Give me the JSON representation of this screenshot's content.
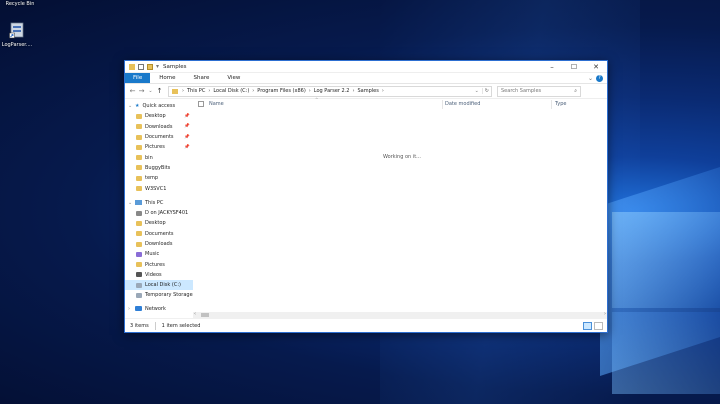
{
  "desktop": {
    "icons": [
      {
        "label": "Recycle Bin",
        "icon": "recycle-bin-icon"
      },
      {
        "label": "LogParser....",
        "icon": "logparser-shortcut-icon"
      }
    ]
  },
  "window": {
    "title": "Samples",
    "ribbon_tabs": [
      "File",
      "Home",
      "Share",
      "View"
    ],
    "breadcrumbs": [
      "This PC",
      "Local Disk (C:)",
      "Program Files (x86)",
      "Log Parser 2.2",
      "Samples"
    ],
    "search_placeholder": "Search Samples",
    "nav": {
      "quick_access": "Quick access",
      "quick_items": [
        {
          "label": "Desktop",
          "pinned": true
        },
        {
          "label": "Downloads",
          "pinned": true
        },
        {
          "label": "Documents",
          "pinned": true
        },
        {
          "label": "Pictures",
          "pinned": true
        },
        {
          "label": "bin",
          "pinned": false
        },
        {
          "label": "BuggyBits",
          "pinned": false
        },
        {
          "label": "temp",
          "pinned": false
        },
        {
          "label": "W3SVC1",
          "pinned": false
        }
      ],
      "this_pc": "This PC",
      "pc_items": [
        "D on JACKYSF401",
        "Desktop",
        "Documents",
        "Downloads",
        "Music",
        "Pictures",
        "Videos",
        "Local Disk (C:)",
        "Temporary Storage"
      ],
      "network": "Network"
    },
    "columns": {
      "checkbox": "",
      "name": "Name",
      "date_modified": "Date modified",
      "type": "Type"
    },
    "working_text": "Working on it...",
    "status": {
      "items": "3 items",
      "selected": "1 item selected"
    }
  },
  "colors": {
    "accent": "#1979ca",
    "selected": "#cce8ff",
    "folder": "#e8c15a"
  }
}
